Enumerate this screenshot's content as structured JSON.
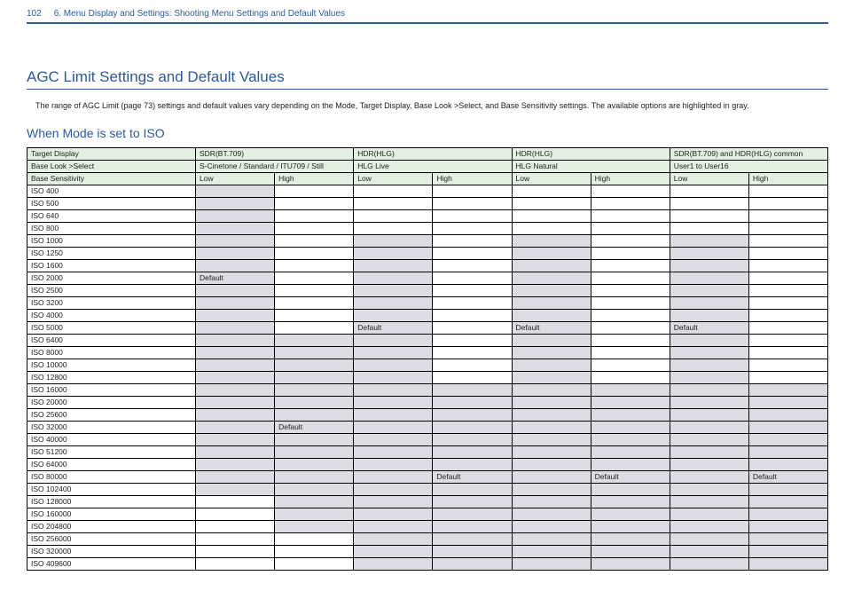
{
  "header": {
    "page_number": "102",
    "path": "6. Menu Display and Settings: Shooting Menu Settings and Default Values"
  },
  "section_title": "AGC Limit Settings and Default Values",
  "intro_text": "The range of AGC Limit (page 73) settings and default values vary depending on the Mode, Target Display, Base Look >Select, and Base Sensitivity settings. The available options are highlighted in gray.",
  "sub_title": "When Mode is set to ISO",
  "table": {
    "row_labels": {
      "target_display": "Target Display",
      "base_look": "Base Look >Select",
      "base_sensitivity": "Base Sensitivity"
    },
    "target_display_values": [
      "SDR(BT.709)",
      "HDR(HLG)",
      "HDR(HLG)",
      "SDR(BT.709) and HDR(HLG) common"
    ],
    "base_look_values": [
      "S-Cinetone / Standard / ITU709 / Still",
      "HLG Live",
      "HLG Natural",
      "User1 to User16"
    ],
    "sensitivity_headers": [
      "Low",
      "High",
      "Low",
      "High",
      "Low",
      "High",
      "Low",
      "High"
    ],
    "iso_rows": [
      {
        "label": "ISO 400",
        "shade": [
          1,
          0,
          0,
          0,
          0,
          0,
          0,
          0
        ],
        "text": [
          "",
          "",
          "",
          "",
          "",
          "",
          "",
          ""
        ]
      },
      {
        "label": "ISO 500",
        "shade": [
          1,
          0,
          0,
          0,
          0,
          0,
          0,
          0
        ],
        "text": [
          "",
          "",
          "",
          "",
          "",
          "",
          "",
          ""
        ]
      },
      {
        "label": "ISO 640",
        "shade": [
          1,
          0,
          0,
          0,
          0,
          0,
          0,
          0
        ],
        "text": [
          "",
          "",
          "",
          "",
          "",
          "",
          "",
          ""
        ]
      },
      {
        "label": "ISO 800",
        "shade": [
          1,
          0,
          0,
          0,
          0,
          0,
          0,
          0
        ],
        "text": [
          "",
          "",
          "",
          "",
          "",
          "",
          "",
          ""
        ]
      },
      {
        "label": "ISO 1000",
        "shade": [
          1,
          0,
          1,
          0,
          1,
          0,
          1,
          0
        ],
        "text": [
          "",
          "",
          "",
          "",
          "",
          "",
          "",
          ""
        ]
      },
      {
        "label": "ISO 1250",
        "shade": [
          1,
          0,
          1,
          0,
          1,
          0,
          1,
          0
        ],
        "text": [
          "",
          "",
          "",
          "",
          "",
          "",
          "",
          ""
        ]
      },
      {
        "label": "ISO 1600",
        "shade": [
          1,
          0,
          1,
          0,
          1,
          0,
          1,
          0
        ],
        "text": [
          "",
          "",
          "",
          "",
          "",
          "",
          "",
          ""
        ]
      },
      {
        "label": "ISO 2000",
        "shade": [
          1,
          0,
          1,
          0,
          1,
          0,
          1,
          0
        ],
        "text": [
          "Default",
          "",
          "",
          "",
          "",
          "",
          "",
          ""
        ]
      },
      {
        "label": "ISO 2500",
        "shade": [
          1,
          0,
          1,
          0,
          1,
          0,
          1,
          0
        ],
        "text": [
          "",
          "",
          "",
          "",
          "",
          "",
          "",
          ""
        ]
      },
      {
        "label": "ISO 3200",
        "shade": [
          1,
          0,
          1,
          0,
          1,
          0,
          1,
          0
        ],
        "text": [
          "",
          "",
          "",
          "",
          "",
          "",
          "",
          ""
        ]
      },
      {
        "label": "ISO 4000",
        "shade": [
          1,
          0,
          1,
          0,
          1,
          0,
          1,
          0
        ],
        "text": [
          "",
          "",
          "",
          "",
          "",
          "",
          "",
          ""
        ]
      },
      {
        "label": "ISO 5000",
        "shade": [
          1,
          0,
          1,
          0,
          1,
          0,
          1,
          0
        ],
        "text": [
          "",
          "",
          "Default",
          "",
          "Default",
          "",
          "Default",
          ""
        ]
      },
      {
        "label": "ISO 6400",
        "shade": [
          1,
          1,
          1,
          0,
          1,
          0,
          1,
          0
        ],
        "text": [
          "",
          "",
          "",
          "",
          "",
          "",
          "",
          ""
        ]
      },
      {
        "label": "ISO 8000",
        "shade": [
          1,
          1,
          1,
          0,
          1,
          0,
          1,
          0
        ],
        "text": [
          "",
          "",
          "",
          "",
          "",
          "",
          "",
          ""
        ]
      },
      {
        "label": "ISO 10000",
        "shade": [
          1,
          1,
          1,
          0,
          1,
          0,
          1,
          0
        ],
        "text": [
          "",
          "",
          "",
          "",
          "",
          "",
          "",
          ""
        ]
      },
      {
        "label": "ISO 12800",
        "shade": [
          1,
          1,
          1,
          0,
          1,
          0,
          1,
          0
        ],
        "text": [
          "",
          "",
          "",
          "",
          "",
          "",
          "",
          ""
        ]
      },
      {
        "label": "ISO 16000",
        "shade": [
          1,
          1,
          1,
          1,
          1,
          1,
          1,
          1
        ],
        "text": [
          "",
          "",
          "",
          "",
          "",
          "",
          "",
          ""
        ]
      },
      {
        "label": "ISO 20000",
        "shade": [
          1,
          1,
          1,
          1,
          1,
          1,
          1,
          1
        ],
        "text": [
          "",
          "",
          "",
          "",
          "",
          "",
          "",
          ""
        ]
      },
      {
        "label": "ISO 25600",
        "shade": [
          1,
          1,
          1,
          1,
          1,
          1,
          1,
          1
        ],
        "text": [
          "",
          "",
          "",
          "",
          "",
          "",
          "",
          ""
        ]
      },
      {
        "label": "ISO 32000",
        "shade": [
          1,
          1,
          1,
          1,
          1,
          1,
          1,
          1
        ],
        "text": [
          "",
          "Default",
          "",
          "",
          "",
          "",
          "",
          ""
        ]
      },
      {
        "label": "ISO 40000",
        "shade": [
          1,
          1,
          1,
          1,
          1,
          1,
          1,
          1
        ],
        "text": [
          "",
          "",
          "",
          "",
          "",
          "",
          "",
          ""
        ]
      },
      {
        "label": "ISO 51200",
        "shade": [
          1,
          1,
          1,
          1,
          1,
          1,
          1,
          1
        ],
        "text": [
          "",
          "",
          "",
          "",
          "",
          "",
          "",
          ""
        ]
      },
      {
        "label": "ISO 64000",
        "shade": [
          1,
          1,
          1,
          1,
          1,
          1,
          1,
          1
        ],
        "text": [
          "",
          "",
          "",
          "",
          "",
          "",
          "",
          ""
        ]
      },
      {
        "label": "ISO 80000",
        "shade": [
          1,
          1,
          1,
          1,
          1,
          1,
          1,
          1
        ],
        "text": [
          "",
          "",
          "",
          "Default",
          "",
          "Default",
          "",
          "Default"
        ]
      },
      {
        "label": "ISO 102400",
        "shade": [
          1,
          1,
          1,
          1,
          1,
          1,
          1,
          1
        ],
        "text": [
          "",
          "",
          "",
          "",
          "",
          "",
          "",
          ""
        ]
      },
      {
        "label": "ISO 128000",
        "shade": [
          0,
          1,
          1,
          1,
          1,
          1,
          1,
          1
        ],
        "text": [
          "",
          "",
          "",
          "",
          "",
          "",
          "",
          ""
        ]
      },
      {
        "label": "ISO 160000",
        "shade": [
          0,
          1,
          1,
          1,
          1,
          1,
          1,
          1
        ],
        "text": [
          "",
          "",
          "",
          "",
          "",
          "",
          "",
          ""
        ]
      },
      {
        "label": "ISO 204800",
        "shade": [
          0,
          1,
          1,
          1,
          1,
          1,
          1,
          1
        ],
        "text": [
          "",
          "",
          "",
          "",
          "",
          "",
          "",
          ""
        ]
      },
      {
        "label": "ISO 256000",
        "shade": [
          0,
          0,
          1,
          1,
          1,
          1,
          1,
          1
        ],
        "text": [
          "",
          "",
          "",
          "",
          "",
          "",
          "",
          ""
        ]
      },
      {
        "label": "ISO 320000",
        "shade": [
          0,
          0,
          1,
          1,
          1,
          1,
          1,
          1
        ],
        "text": [
          "",
          "",
          "",
          "",
          "",
          "",
          "",
          ""
        ]
      },
      {
        "label": "ISO 409600",
        "shade": [
          0,
          0,
          1,
          1,
          1,
          1,
          1,
          1
        ],
        "text": [
          "",
          "",
          "",
          "",
          "",
          "",
          "",
          ""
        ]
      }
    ]
  }
}
